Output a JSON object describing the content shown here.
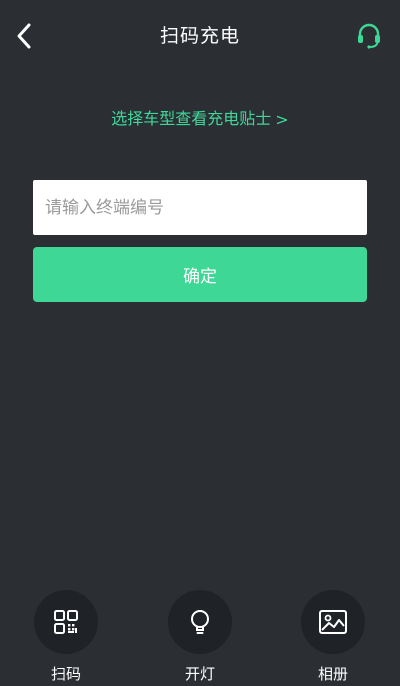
{
  "header": {
    "title": "扫码充电",
    "back_icon": "chevron-left-icon",
    "support_icon": "headset-icon"
  },
  "tips": {
    "label": "选择车型查看充电贴士",
    "chevron": ">"
  },
  "form": {
    "terminal_placeholder": "请输入终端编号",
    "terminal_value": "",
    "confirm_label": "确定"
  },
  "actions": [
    {
      "label": "扫码",
      "icon": "qr-code-icon"
    },
    {
      "label": "开灯",
      "icon": "lightbulb-icon"
    },
    {
      "label": "相册",
      "icon": "image-icon"
    }
  ],
  "colors": {
    "background": "#2b2e33",
    "accent": "#3ed796",
    "circle": "#1f2226"
  }
}
